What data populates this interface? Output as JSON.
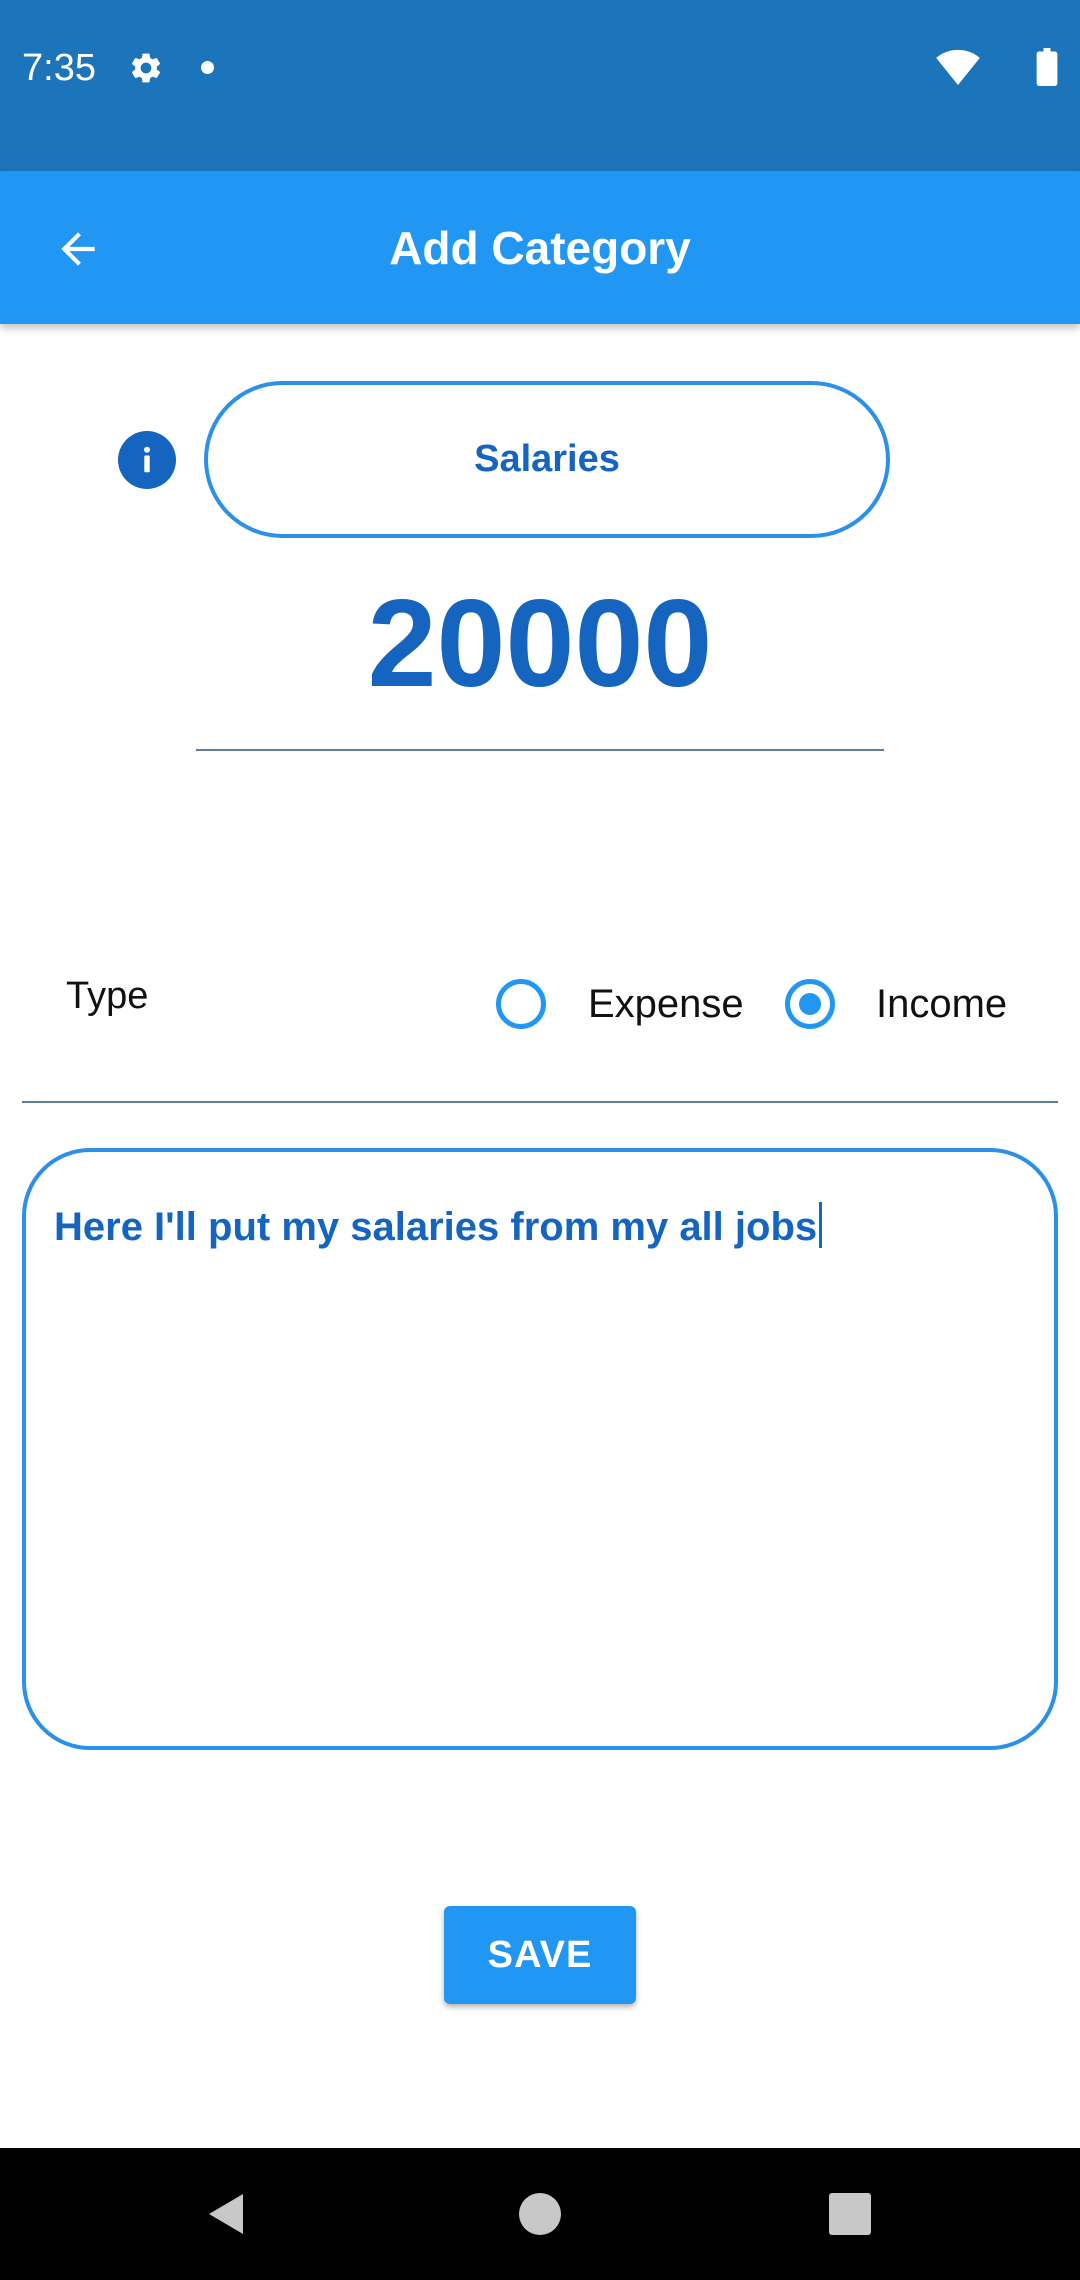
{
  "status_bar": {
    "time": "7:35",
    "icons": [
      "gear-icon",
      "notification-dot-icon",
      "wifi-icon",
      "battery-icon"
    ]
  },
  "app_bar": {
    "title": "Add Category",
    "back_icon": "arrow-left-icon"
  },
  "form": {
    "category_name": "Salaries",
    "amount": "20000",
    "type": {
      "label": "Type",
      "options": [
        "Expense",
        "Income"
      ],
      "selected": "Income"
    },
    "description": "Here I'll put my salaries from my all jobs",
    "save_label": "SAVE"
  },
  "colors": {
    "status_bar": "#1c74bb",
    "app_bar": "#2196f3",
    "accent_text": "#1565c0",
    "border": "#2c8fe8"
  }
}
